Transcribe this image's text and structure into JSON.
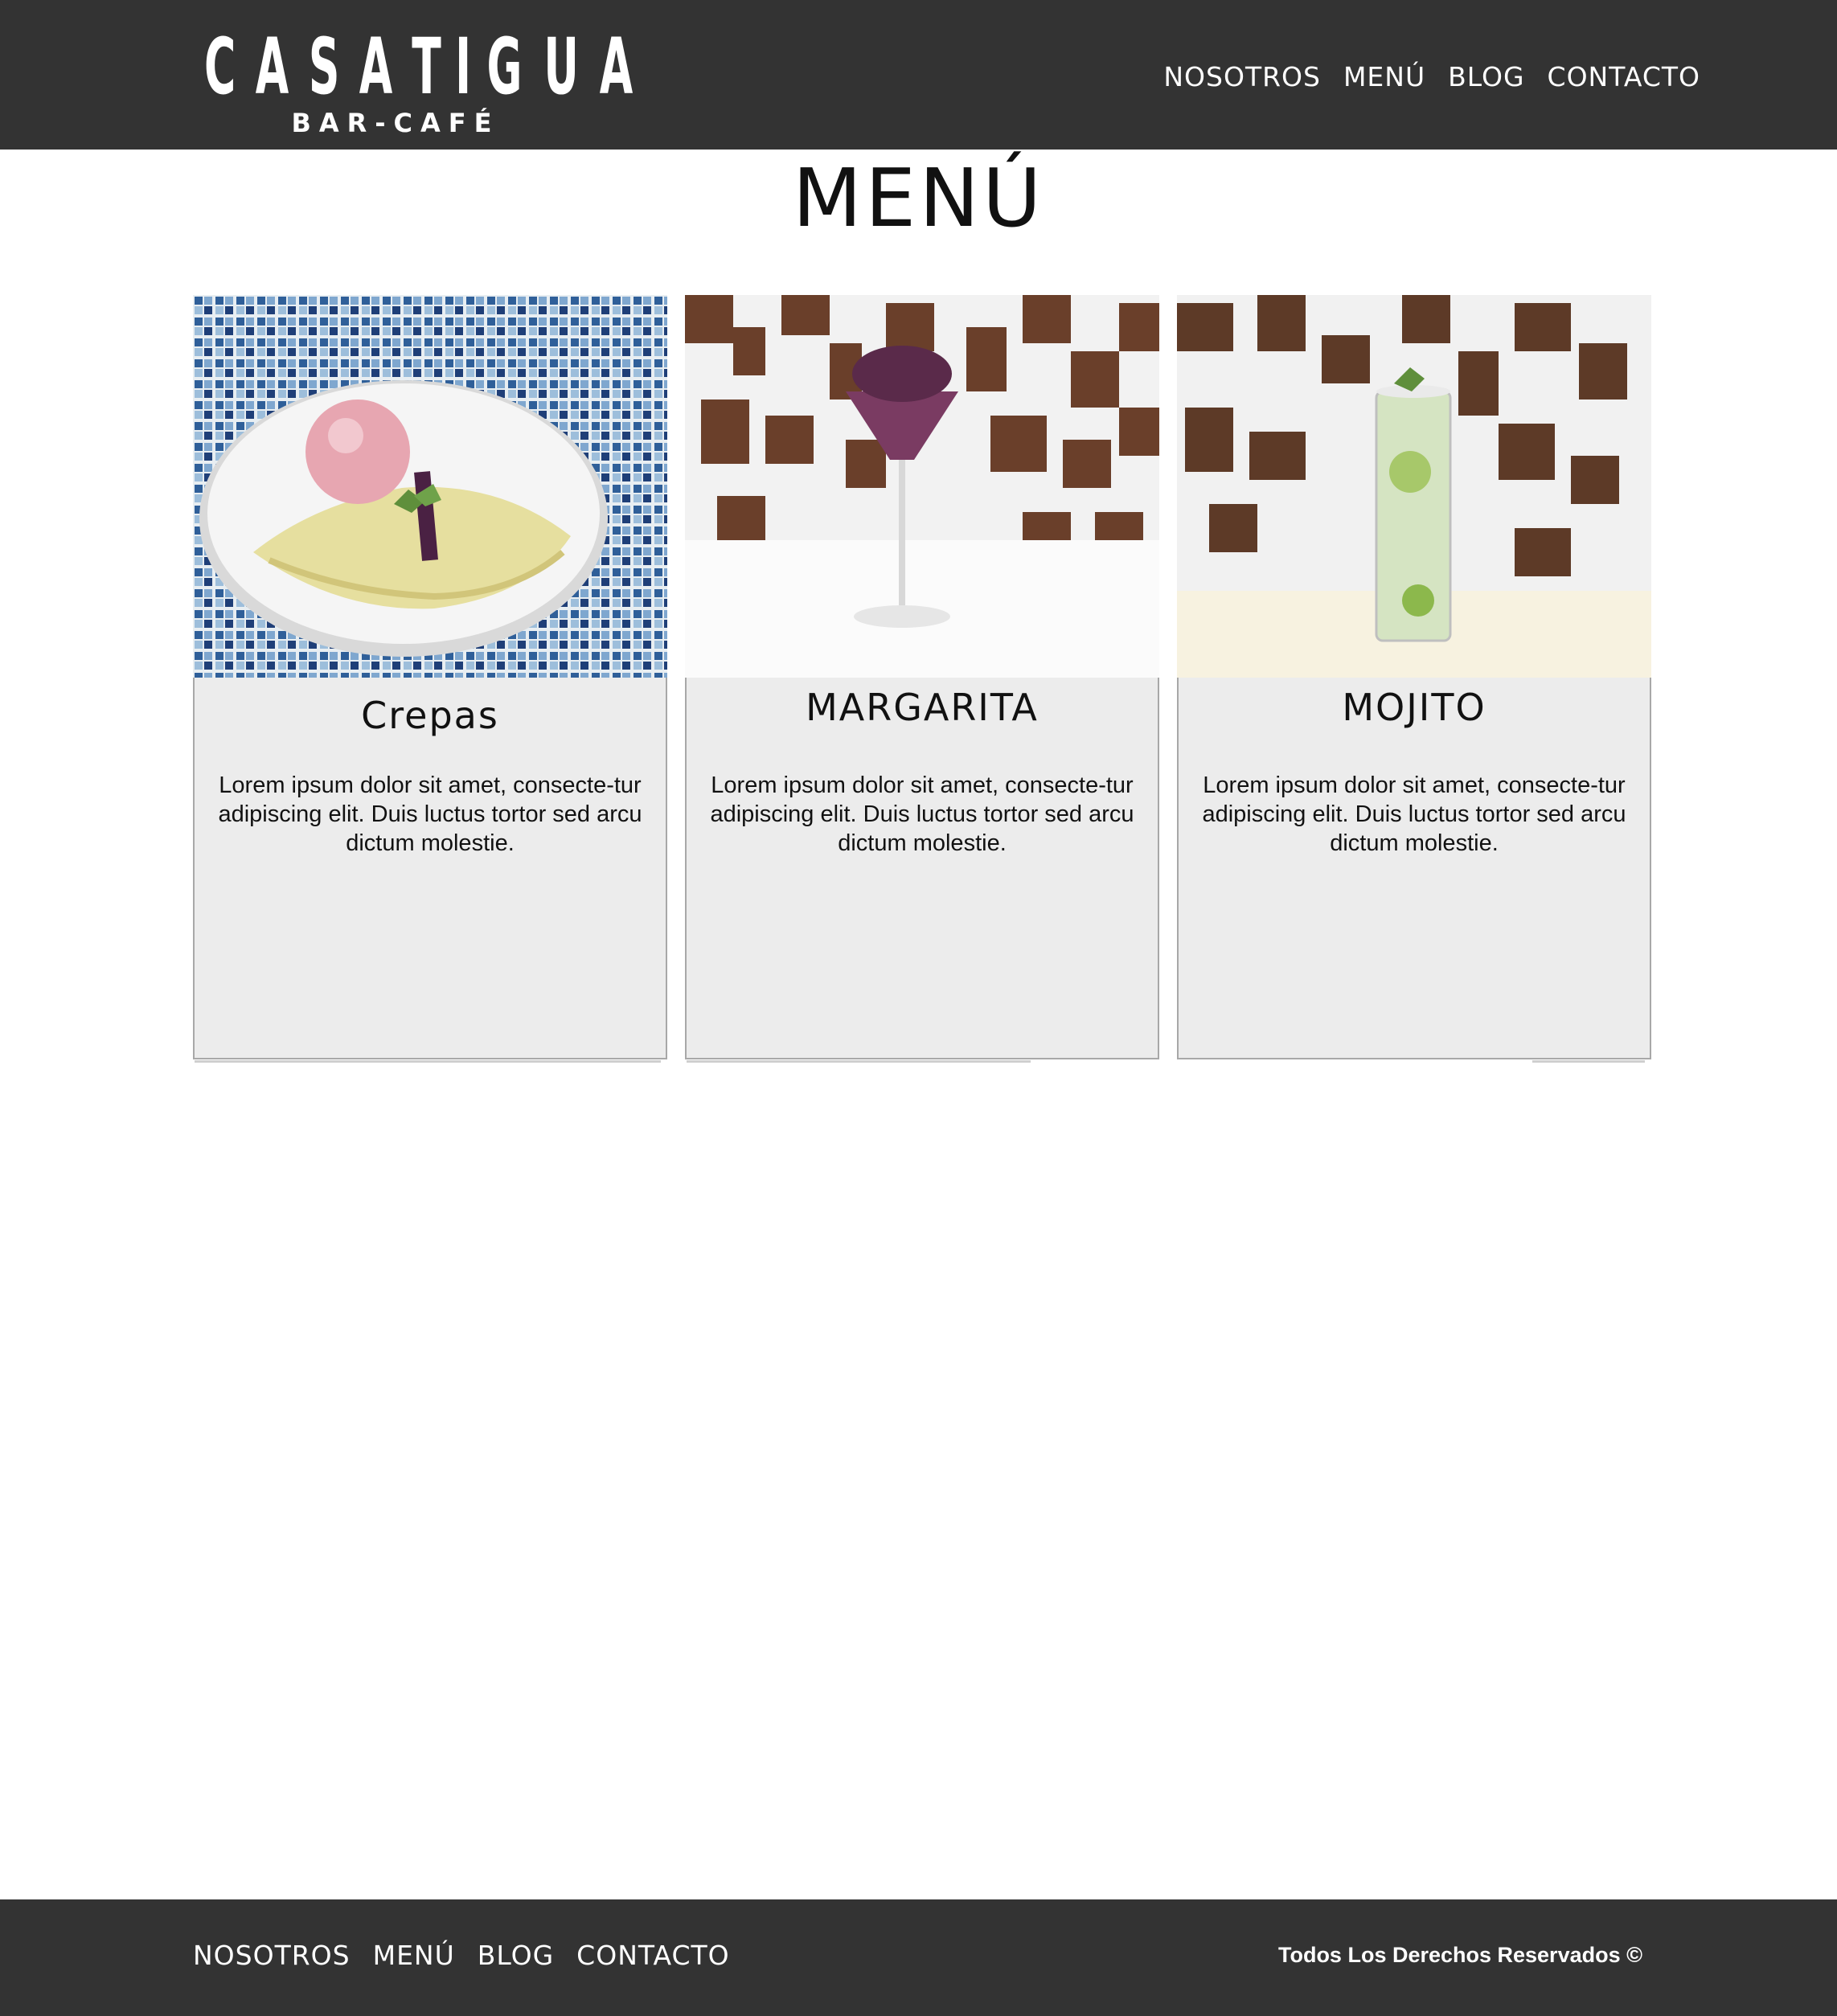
{
  "header": {
    "logo_main_letters": [
      "C",
      "A",
      "S",
      "A",
      "T",
      "I",
      "G",
      "U",
      "A"
    ],
    "logo_sub": "BAR-CAFÉ",
    "nav": [
      "NOSOTROS",
      "MENÚ",
      "BLOG",
      "CONTACTO"
    ]
  },
  "page": {
    "title": "MENÚ"
  },
  "cards": [
    {
      "title": "Crepas",
      "description": "Lorem ipsum dolor sit amet, consecte-tur adipiscing elit. Duis luctus tortor sed arcu dictum molestie.",
      "photo": "crepe-with-ice-cream-photo"
    },
    {
      "title": "MARGARITA",
      "description": "Lorem ipsum dolor sit amet, consecte-tur adipiscing elit. Duis luctus tortor sed arcu dictum molestie.",
      "photo": "margarita-glass-photo"
    },
    {
      "title": "MOJITO",
      "description": "Lorem ipsum dolor sit amet, consecte-tur adipiscing elit. Duis luctus tortor sed arcu dictum molestie.",
      "photo": "mojito-glass-photo"
    }
  ],
  "footer": {
    "nav": [
      "NOSOTROS",
      "MENÚ",
      "BLOG",
      "CONTACTO"
    ],
    "copyright": "Todos Los Derechos Reservados ©"
  },
  "colors": {
    "bar": "#333333",
    "card_body": "#ececec",
    "card_border": "#a8a8a8"
  }
}
